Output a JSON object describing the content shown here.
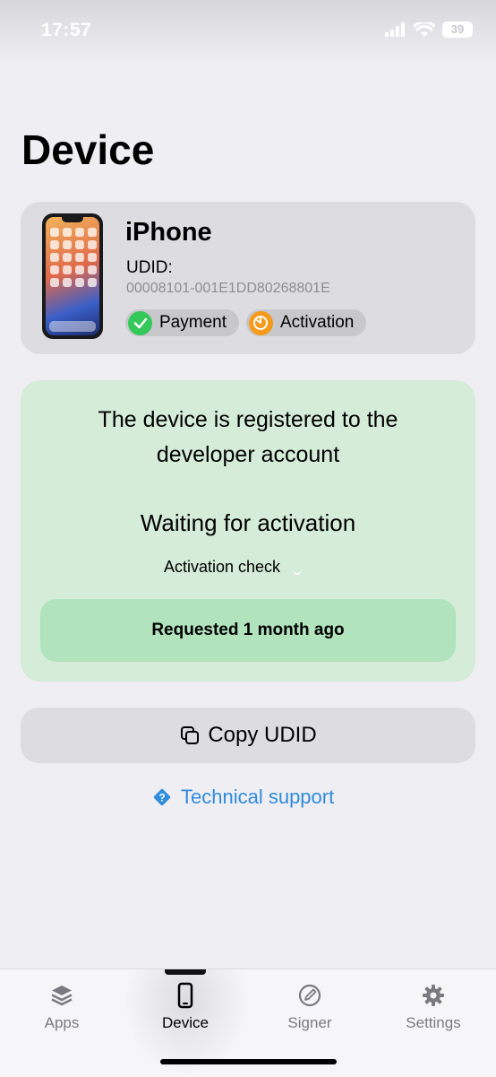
{
  "status_bar": {
    "time": "17:57",
    "battery": "39"
  },
  "page": {
    "title": "Device"
  },
  "device_card": {
    "name": "iPhone",
    "udid_label": "UDID:",
    "udid_value": "00008101-001E1DD80268801E",
    "badges": [
      {
        "label": "Payment",
        "icon": "checkmark-icon",
        "color": "#34c759"
      },
      {
        "label": "Activation",
        "icon": "timer-icon",
        "color": "#f59a1b"
      }
    ]
  },
  "status_card": {
    "registered_text": "The device is registered to the developer account",
    "waiting_text": "Waiting for activation",
    "activation_check": "Activation check",
    "requested": "Requested 1 month ago",
    "background": "#d4ecd8"
  },
  "actions": {
    "copy_udid": "Copy UDID",
    "support": "Technical support",
    "accent": "#2f8bdc"
  },
  "tab_bar": {
    "tabs": [
      {
        "label": "Apps",
        "icon": "layers-icon"
      },
      {
        "label": "Device",
        "icon": "phone-icon",
        "active": true
      },
      {
        "label": "Signer",
        "icon": "signer-icon"
      },
      {
        "label": "Settings",
        "icon": "gear-icon"
      }
    ]
  }
}
